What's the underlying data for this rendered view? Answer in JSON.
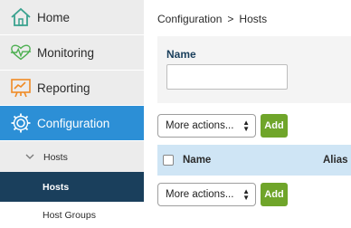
{
  "sidebar": {
    "items": [
      {
        "label": "Home",
        "icon": "home-icon"
      },
      {
        "label": "Monitoring",
        "icon": "heartbeat-icon"
      },
      {
        "label": "Reporting",
        "icon": "chart-board-icon"
      },
      {
        "label": "Configuration",
        "icon": "gear-icon"
      }
    ],
    "submenu": {
      "group_label": "Hosts",
      "active_label": "Hosts",
      "next_label": "Host Groups"
    }
  },
  "breadcrumb": {
    "parent": "Configuration",
    "separator": ">",
    "current": "Hosts"
  },
  "filter": {
    "name_label": "Name",
    "name_value": ""
  },
  "actions": {
    "select_label": "More actions...",
    "add_label": "Add"
  },
  "table": {
    "columns": [
      "Name",
      "Alias"
    ]
  },
  "colors": {
    "active_nav": "#2c8fd6",
    "active_sub": "#1a3f5c",
    "add_button": "#6fa52a",
    "table_header": "#cfe5f5"
  }
}
